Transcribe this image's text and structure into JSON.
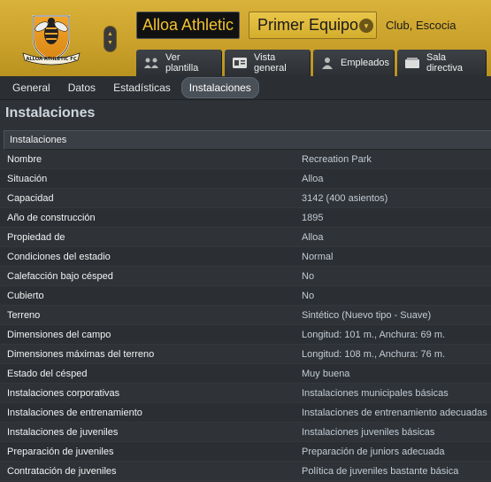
{
  "header": {
    "crest_text": "ALLOA ATHLETIC FC",
    "club_name": "Alloa Athletic",
    "team_selector": "Primer Equipo",
    "club_country": "Club, Escocia",
    "nav_tabs": [
      {
        "label": "Ver plantilla",
        "icon": "squad-icon"
      },
      {
        "label": "Vista general",
        "icon": "id-card-icon"
      },
      {
        "label": "Empleados",
        "icon": "person-icon"
      },
      {
        "label": "Sala directiva",
        "icon": "board-room-icon"
      }
    ]
  },
  "subtabs": [
    "General",
    "Datos",
    "Estadísticas",
    "Instalaciones"
  ],
  "page_title": "Instalaciones",
  "table": {
    "header": "Instalaciones",
    "rows": [
      {
        "label": "Nombre",
        "value": "Recreation Park"
      },
      {
        "label": "Situación",
        "value": "Alloa"
      },
      {
        "label": "Capacidad",
        "value": "3142 (400 asientos)"
      },
      {
        "label": "Año de construcción",
        "value": "1895"
      },
      {
        "label": "Propiedad de",
        "value": "Alloa"
      },
      {
        "label": "Condiciones del estadio",
        "value": "Normal"
      },
      {
        "label": "Calefacción bajo césped",
        "value": "No"
      },
      {
        "label": "Cubierto",
        "value": "No"
      },
      {
        "label": "Terreno",
        "value": "Sintético (Nuevo tipo - Suave)"
      },
      {
        "label": "Dimensiones del campo",
        "value": "Longitud: 101 m., Anchura: 69 m."
      },
      {
        "label": "Dimensiones máximas del terreno",
        "value": "Longitud: 108 m., Anchura: 76 m."
      },
      {
        "label": "Estado del césped",
        "value": "Muy buena"
      },
      {
        "label": "Instalaciones corporativas",
        "value": "Instalaciones municipales básicas"
      },
      {
        "label": "Instalaciones de entrenamiento",
        "value": "Instalaciones de entrenamiento adecuadas"
      },
      {
        "label": "Instalaciones de juveniles",
        "value": "Instalaciones juveniles básicas"
      },
      {
        "label": "Preparación de juveniles",
        "value": "Preparación de juniors adecuada"
      },
      {
        "label": "Contratación de juveniles",
        "value": "Política de juveniles bastante básica"
      }
    ]
  },
  "colors": {
    "header_gold": "#d9b23a",
    "club_name_text": "#f2c230",
    "background": "#2e3237",
    "title_text": "#cfd6dd",
    "value_text": "#c3cbd3"
  }
}
